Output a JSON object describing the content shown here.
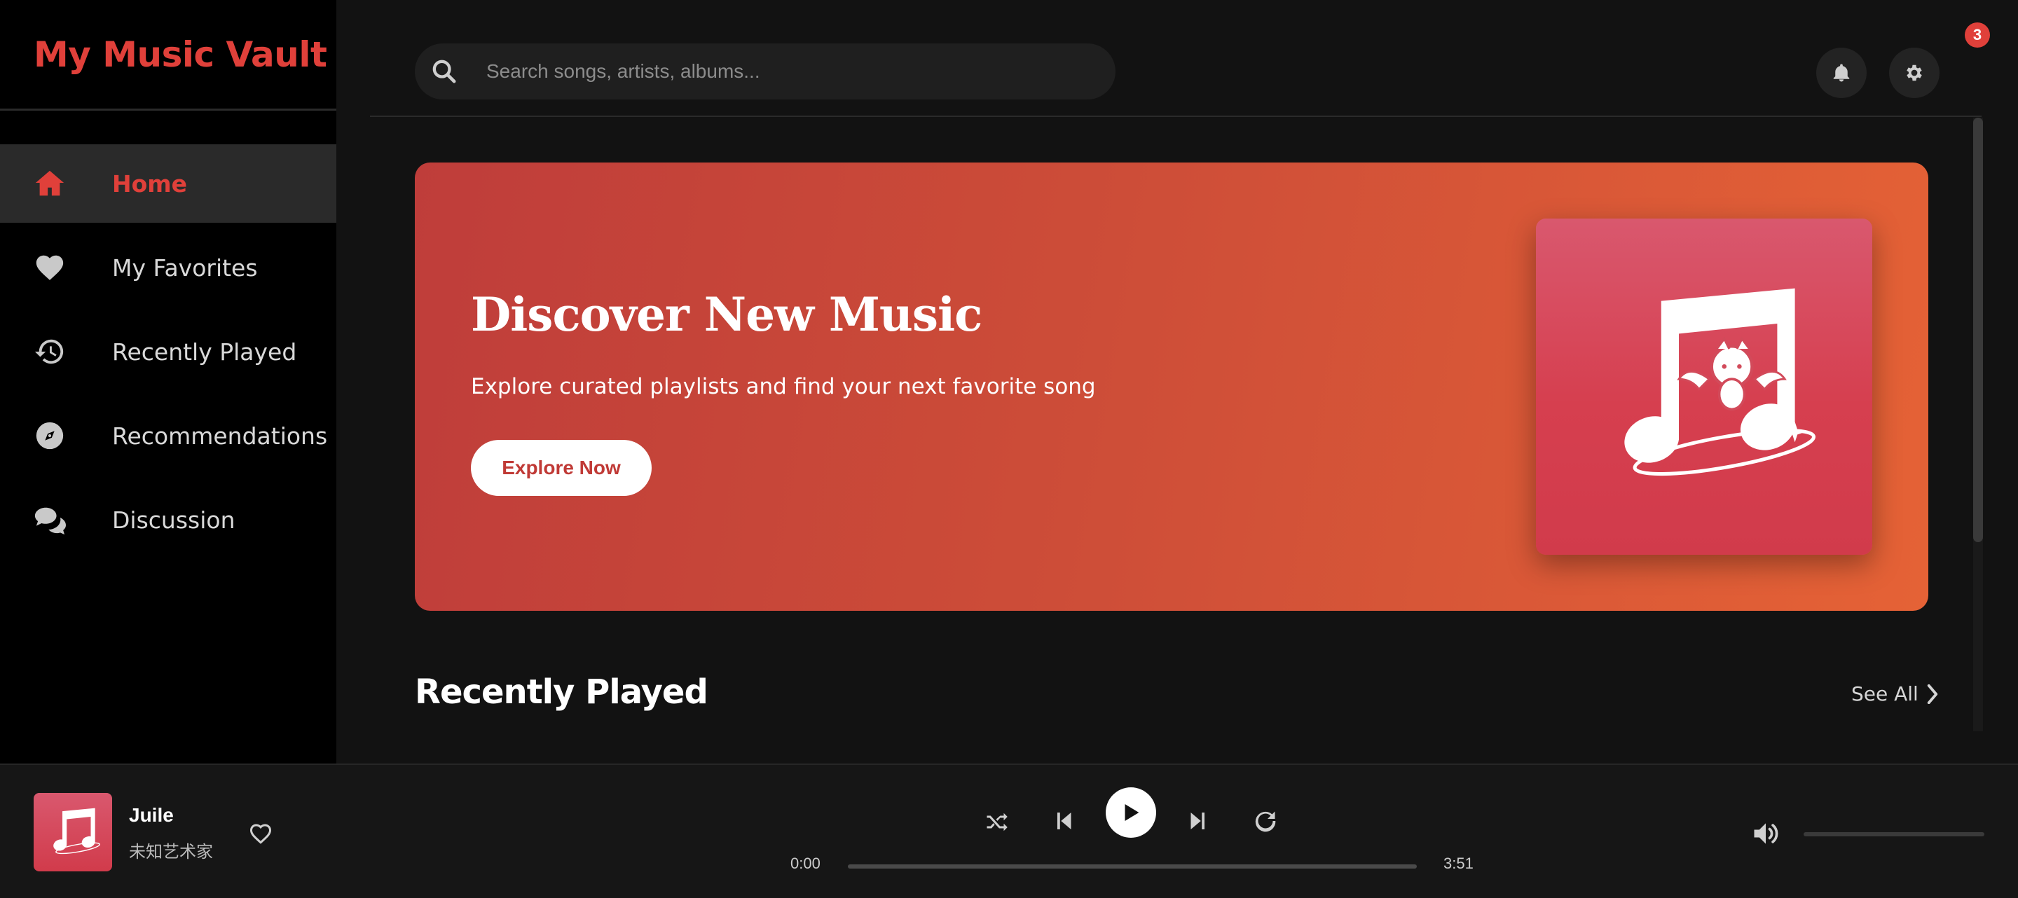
{
  "app": {
    "title": "My Music Vault"
  },
  "sidebar": {
    "items": [
      {
        "label": "Home",
        "icon": "home-icon",
        "active": true
      },
      {
        "label": "My Favorites",
        "icon": "heart-icon",
        "active": false
      },
      {
        "label": "Recently Played",
        "icon": "history-icon",
        "active": false
      },
      {
        "label": "Recommendations",
        "icon": "compass-icon",
        "active": false
      },
      {
        "label": "Discussion",
        "icon": "comments-icon",
        "active": false
      }
    ]
  },
  "search": {
    "placeholder": "Search songs, artists, albums...",
    "value": ""
  },
  "header": {
    "notification_count": "3"
  },
  "hero": {
    "title": "Discover New Music",
    "subtitle": "Explore curated playlists and find your next favorite song",
    "button_label": "Explore Now"
  },
  "recently_played": {
    "title": "Recently Played",
    "see_all_label": "See All"
  },
  "player": {
    "track_title": "Juile",
    "track_artist": "未知艺术家",
    "current_time": "0:00",
    "duration": "3:51",
    "progress_fraction": 0,
    "volume_fraction": 0
  },
  "colors": {
    "accent": "#e0403a",
    "background": "#121212",
    "sidebar": "#000000",
    "hero_start": "#bf3d3a",
    "hero_end": "#e56236"
  }
}
